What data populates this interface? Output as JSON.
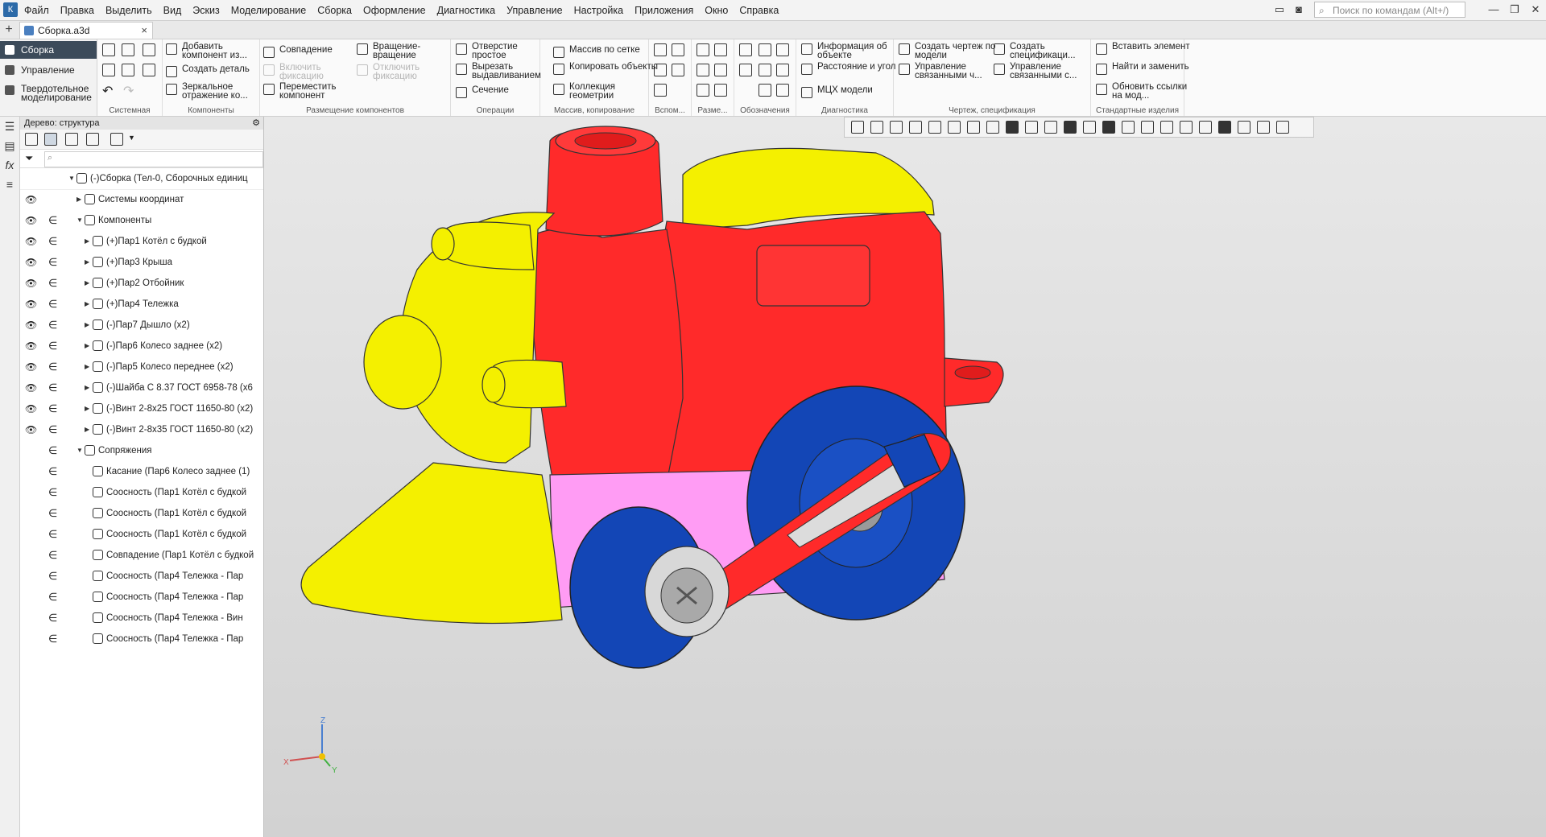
{
  "menu": {
    "items": [
      "Файл",
      "Правка",
      "Выделить",
      "Вид",
      "Эскиз",
      "Моделирование",
      "Сборка",
      "Оформление",
      "Диагностика",
      "Управление",
      "Настройка",
      "Приложения",
      "Окно",
      "Справка"
    ],
    "search_placeholder": "Поиск по командам (Alt+/)"
  },
  "tab": {
    "title": "Сборка.a3d",
    "close": "×",
    "add": "+"
  },
  "modes": {
    "active": "Сборка",
    "items": [
      "Сборка",
      "Управление",
      "Твердотельное моделирование"
    ]
  },
  "ribbon": {
    "groups": [
      "Системная",
      "Компоненты",
      "Размещение компонентов",
      "Операции",
      "Массив, копирование",
      "Вспом...",
      "Разме...",
      "Обозначения",
      "Диагностика",
      "Чертеж, спецификация",
      "Стандартные изделия"
    ],
    "components": [
      "Добавить компонент из...",
      "Создать деталь",
      "Зеркальное отражение ко..."
    ],
    "placement": [
      "Совпадение",
      "Вращение-вращение",
      "Включить фиксацию",
      "Отключить фиксацию",
      "Переместить компонент"
    ],
    "operations": [
      "Отверстие простое",
      "Вырезать выдавливанием",
      "Сечение"
    ],
    "array": [
      "Массив по сетке",
      "Копировать объекты",
      "Коллекция геометрии"
    ],
    "diagnostics": [
      "Информация об объекте",
      "Расстояние и угол",
      "МЦХ модели"
    ],
    "drawing": [
      "Создать чертеж по модели",
      "Создать спецификаци...",
      "Управление связанными ч...",
      "Управление связанными с..."
    ],
    "standard": [
      "Вставить элемент",
      "Найти и заменить",
      "Обновить ссылки на мод..."
    ]
  },
  "tree": {
    "header": "Дерево: структура",
    "rows": [
      {
        "label": "(-)Сборка (Тел-0, Сборочных единиц",
        "eye": false,
        "link": false,
        "arrow": "▼",
        "level": 0
      },
      {
        "label": "Системы координат",
        "eye": true,
        "link": false,
        "arrow": "▶",
        "level": 1
      },
      {
        "label": "Компоненты",
        "eye": true,
        "link": true,
        "arrow": "▼",
        "level": 1
      },
      {
        "label": "(+)Пар1 Котёл с будкой",
        "eye": true,
        "link": true,
        "arrow": "▶",
        "level": 2
      },
      {
        "label": "(+)Пар3 Крыша",
        "eye": true,
        "link": true,
        "arrow": "▶",
        "level": 2
      },
      {
        "label": "(+)Пар2 Отбойник",
        "eye": true,
        "link": true,
        "arrow": "▶",
        "level": 2
      },
      {
        "label": "(+)Пар4 Тележка",
        "eye": true,
        "link": true,
        "arrow": "▶",
        "level": 2
      },
      {
        "label": "(-)Пар7 Дышло (x2)",
        "eye": true,
        "link": true,
        "arrow": "▶",
        "level": 2
      },
      {
        "label": "(-)Пар6 Колесо заднее (x2)",
        "eye": true,
        "link": true,
        "arrow": "▶",
        "level": 2
      },
      {
        "label": "(-)Пар5 Колесо переднее (x2)",
        "eye": true,
        "link": true,
        "arrow": "▶",
        "level": 2
      },
      {
        "label": "(-)Шайба С 8.37 ГОСТ 6958-78 (x6",
        "eye": true,
        "link": true,
        "arrow": "▶",
        "level": 2
      },
      {
        "label": "(-)Винт 2-8x25 ГОСТ 11650-80 (x2)",
        "eye": true,
        "link": true,
        "arrow": "▶",
        "level": 2
      },
      {
        "label": "(-)Винт 2-8x35 ГОСТ 11650-80 (x2)",
        "eye": true,
        "link": true,
        "arrow": "▶",
        "level": 2
      },
      {
        "label": "Сопряжения",
        "eye": false,
        "link": true,
        "arrow": "▼",
        "level": 1
      },
      {
        "label": "Касание (Пар6 Колесо заднее (1)",
        "eye": false,
        "link": true,
        "arrow": "",
        "level": 2
      },
      {
        "label": "Соосность (Пар1 Котёл с будкой",
        "eye": false,
        "link": true,
        "arrow": "",
        "level": 2
      },
      {
        "label": "Соосность (Пар1 Котёл с будкой",
        "eye": false,
        "link": true,
        "arrow": "",
        "level": 2
      },
      {
        "label": "Соосность (Пар1 Котёл с будкой",
        "eye": false,
        "link": true,
        "arrow": "",
        "level": 2
      },
      {
        "label": "Совпадение (Пар1 Котёл с будкой",
        "eye": false,
        "link": true,
        "arrow": "",
        "level": 2
      },
      {
        "label": "Соосность (Пар4 Тележка  -  Пар",
        "eye": false,
        "link": true,
        "arrow": "",
        "level": 2
      },
      {
        "label": "Соосность (Пар4 Тележка  -  Пар",
        "eye": false,
        "link": true,
        "arrow": "",
        "level": 2
      },
      {
        "label": "Соосность (Пар4 Тележка  -  Вин",
        "eye": false,
        "link": true,
        "arrow": "",
        "level": 2
      },
      {
        "label": "Соосность (Пар4 Тележка  -  Пар",
        "eye": false,
        "link": true,
        "arrow": "",
        "level": 2
      }
    ]
  },
  "axes": {
    "x": "X",
    "y": "Y",
    "z": "Z"
  },
  "colors": {
    "accent": "#3c4b5a",
    "yellow": "#f4f000",
    "red": "#ff2a2a",
    "blue": "#1346b6",
    "pink": "#ff9cf4"
  }
}
